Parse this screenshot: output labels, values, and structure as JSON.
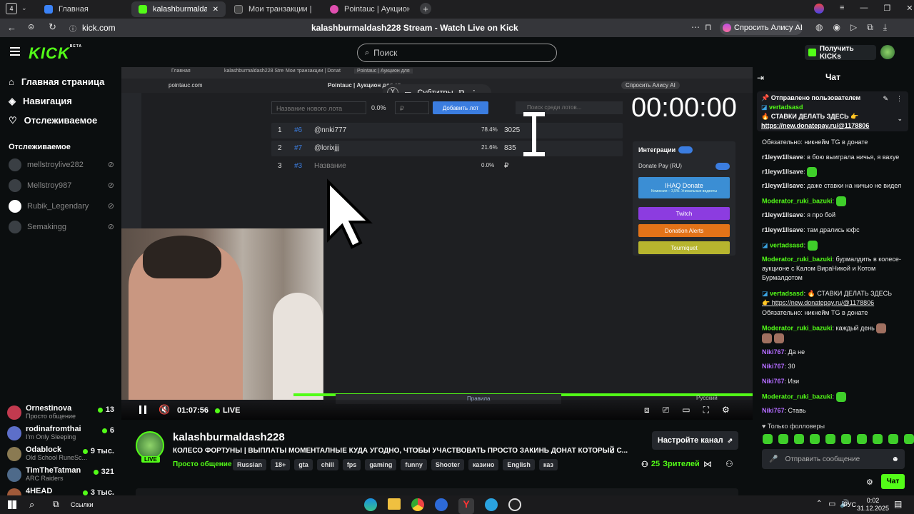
{
  "browser": {
    "tab_count": "4",
    "tabs": [
      {
        "label": "Главная",
        "color": "#3b82f6"
      },
      {
        "label": "kalashburmaldash228 S",
        "color": "#53fc18"
      },
      {
        "label": "Мои транзакции | Donate",
        "color": "#222"
      },
      {
        "label": "Pointauc | Аукцион для ст",
        "color": "#e04fb0"
      }
    ],
    "url": "kick.com",
    "page_title": "kalashburmaldash228 Stream - Watch Live on Kick",
    "alisa": "Спросить Алису AI"
  },
  "header": {
    "logo": "KICK",
    "logo_beta": "BETA",
    "search_placeholder": "Поиск",
    "get_kicks": "Получить KICKs"
  },
  "sidebar": {
    "nav": [
      {
        "label": "Главная страница",
        "icon": "home-icon"
      },
      {
        "label": "Навигация",
        "icon": "compass-icon"
      },
      {
        "label": "Отслеживаемое",
        "icon": "heart-icon"
      }
    ],
    "following_title": "Отслеживаемое",
    "following": [
      {
        "name": "mellstroylive282"
      },
      {
        "name": "Mellstroy987"
      },
      {
        "name": "Rubik_Legendary"
      },
      {
        "name": "Semakingg"
      }
    ],
    "channels": [
      {
        "name": "Ornestinova",
        "category": "Просто общение",
        "count": "13",
        "color": "#c23a4f"
      },
      {
        "name": "rodinafromthai",
        "category": "I'm Only Sleeping",
        "count": "6",
        "color": "#5d6fc9"
      },
      {
        "name": "Odablock",
        "category": "Old School RuneSc...",
        "count": "9 тыс.",
        "color": "#8a7a52"
      },
      {
        "name": "TimTheTatman",
        "category": "ARC Raiders",
        "count": "321",
        "color": "#4e6a8a"
      },
      {
        "name": "4HEAD",
        "category": "",
        "count": "3 тыс.",
        "color": "#a05a3a"
      }
    ]
  },
  "stream_screen": {
    "tabs": [
      "Главная",
      "kalashburmaldash228 Stre",
      "Мои транзакции | Donat",
      "Pointauc | Аукцион для"
    ],
    "url": "pointauc.com",
    "page_title": "Pointauc | Аукцион для ст",
    "subtitles": "Субтитры",
    "alisa": "Спросить Алису AI",
    "new_lot_placeholder": "Название нового лота",
    "percent": "0.0%",
    "currency": "₽",
    "add_lot": "Добавить лот",
    "search_lots": "Поиск среди лотов...",
    "timer": "00:00:00",
    "lots": [
      {
        "num": "1",
        "id": "#6",
        "name": "@nnki777",
        "pct": "78.4%",
        "amount": "3025"
      },
      {
        "num": "2",
        "id": "#7",
        "name": "@lorixjjj",
        "pct": "21.6%",
        "amount": "835"
      },
      {
        "num": "3",
        "id": "#3",
        "name": "Название",
        "pct": "0.0%",
        "amount": "₽"
      }
    ],
    "integrations_title": "Интеграции",
    "donate_pay": "Donate Pay (RU)",
    "ihaq": "IHAQ Donate",
    "ihaq_sub": "Комиссия – 3,5%. Уникальные виджеты",
    "twitch": "Twitch",
    "donation_alerts": "Donation Alerts",
    "tourniquet": "Tourniquet",
    "bottom_rules": "Правила",
    "bottom_lang": "Русский"
  },
  "player": {
    "time": "01:07:56",
    "live": "LIVE",
    "progress": 1.0
  },
  "stream_info": {
    "channel": "kalashburmaldash228",
    "live_badge": "LIVE",
    "title": "КОЛЕСО ФОРТУНЫ | ВЫПЛАТЫ МОМЕНТАЛНЫЕ КУДА УГОДНО, ЧТОБЫ УЧАСТВОВАТЬ ПРОСТО ЗАКИНЬ ДОНАТ КОТОРЫЙ С...",
    "category": "Просто общение",
    "tags": [
      "Russian",
      "18+",
      "gta",
      "chill",
      "fps",
      "gaming",
      "funny",
      "Shooter",
      "казино",
      "English",
      "каз"
    ],
    "setup_button": "Настройте канал",
    "viewers": "25",
    "viewers_label": "Зрителей"
  },
  "chat": {
    "title": "Чат",
    "pinned_header": "Отправлено пользователем",
    "pinned_user": "vertadsasd",
    "pinned_text": "🔥 СТАВКИ ДЕЛАТЬ ЗДЕСЬ 👉",
    "pinned_link": "https://new.donatepay.ru/@1178806",
    "messages": [
      {
        "user": "",
        "text": "Обязательно: никнейм TG в донате",
        "color": "#ffffff"
      },
      {
        "user": "r1leyw1llsave",
        "text": "в бою выиграла ничья, я вахуе",
        "color": "#ffffff"
      },
      {
        "user": "r1leyw1llsave",
        "text": "",
        "color": "#ffffff"
      },
      {
        "user": "r1leyw1llsave",
        "text": "даже ставки на ничью не видел",
        "color": "#ffffff"
      },
      {
        "user": "Moderator_ruki_bazuki",
        "text": "",
        "color": "#53fc18"
      },
      {
        "user": "r1leyw1llsave",
        "text": "я про бой",
        "color": "#ffffff"
      },
      {
        "user": "r1leyw1llsave",
        "text": "там дрались юфс",
        "color": "#ffffff"
      },
      {
        "user": "vertadsasd",
        "text": "",
        "color": "#53fc18"
      },
      {
        "user": "Moderator_ruki_bazuki",
        "text": "бурмалдить в колесе-аукционе с Калом ВираНикой и Котом Бурмалдотом",
        "color": "#53fc18"
      },
      {
        "user": "vertadsasd",
        "text": "🔥 СТАВКИ ДЕЛАТЬ ЗДЕСЬ",
        "color": "#53fc18"
      },
      {
        "user": "",
        "text": "👉 https://new.donatepay.ru/@1178806",
        "color": "#ffffff"
      },
      {
        "user": "",
        "text": "Обязательно: никнейм TG в донате",
        "color": "#ffffff"
      },
      {
        "user": "Moderator_ruki_bazuki",
        "text": "каждый день",
        "color": "#53fc18"
      },
      {
        "user": "Niki767",
        "text": "Да не",
        "color": "#b36bff"
      },
      {
        "user": "Niki767",
        "text": "30",
        "color": "#b36bff"
      },
      {
        "user": "Niki767",
        "text": "Изи",
        "color": "#b36bff"
      },
      {
        "user": "Moderator_ruki_bazuki",
        "text": "",
        "color": "#53fc18"
      },
      {
        "user": "Niki767",
        "text": "Ставь",
        "color": "#b36bff"
      }
    ],
    "followers_only": "Только фолловеры",
    "input_placeholder": "Отправить сообщение",
    "send_button": "Чат"
  },
  "taskbar": {
    "links": "Ссылки",
    "lang": "РУС",
    "time": "0:02",
    "date": "31.12.2025"
  },
  "colors": {
    "accent": "#53fc18",
    "bg": "#0b0e0f",
    "purple": "#b36bff"
  }
}
